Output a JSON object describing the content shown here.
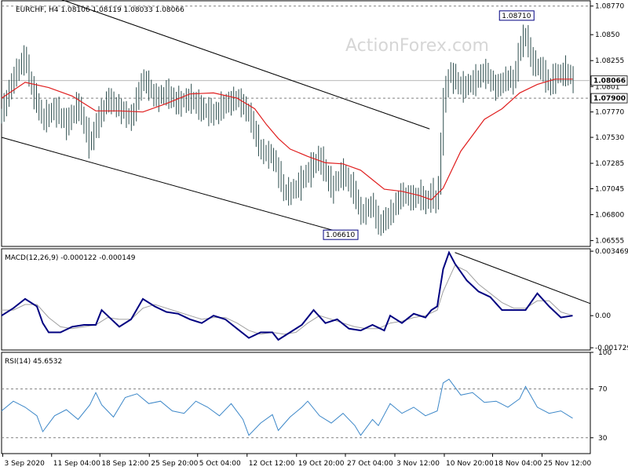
{
  "chart_data": {
    "type": "line",
    "symbol": "EURCHF",
    "timeframe": "H4",
    "watermark": "ActionForex.com",
    "price_panel": {
      "header": "EURCHF, H4  1.08106 1.08119 1.08033 1.08066",
      "price_range": [
        1.065,
        1.0882
      ],
      "y_ticks": [
        "1.08770",
        "1.0850",
        "1.08255",
        "1.0801",
        "1.07770",
        "1.07530",
        "1.07285",
        "1.07045",
        "1.06800",
        "1.06555"
      ],
      "y_tick_values": [
        1.0877,
        1.085,
        1.08255,
        1.0801,
        1.0777,
        1.0753,
        1.07285,
        1.07045,
        1.068,
        1.06555
      ],
      "current_price_label": "1.08066",
      "current_price": 1.08066,
      "support_label": "1.07900",
      "support_level": 1.079,
      "top_dashed_level": 1.0877,
      "annotations": [
        {
          "text": "1.08710",
          "price": 1.0871,
          "t": 0.883
        },
        {
          "text": "1.06610",
          "price": 1.0661,
          "t": 0.584
        }
      ],
      "channel_upper": [
        [
          0.0,
          1.0903
        ],
        [
          0.727,
          1.0761
        ]
      ],
      "channel_lower": [
        [
          0.0,
          1.0753
        ],
        [
          0.59,
          1.0661
        ]
      ],
      "close_path": [
        [
          0.0,
          1.0775
        ],
        [
          0.02,
          1.081
        ],
        [
          0.04,
          1.083
        ],
        [
          0.05,
          1.08
        ],
        [
          0.07,
          1.077
        ],
        [
          0.09,
          1.078
        ],
        [
          0.11,
          1.0765
        ],
        [
          0.13,
          1.0785
        ],
        [
          0.15,
          1.0745
        ],
        [
          0.16,
          1.0765
        ],
        [
          0.18,
          1.079
        ],
        [
          0.2,
          1.078
        ],
        [
          0.22,
          1.077
        ],
        [
          0.24,
          1.081
        ],
        [
          0.26,
          1.079
        ],
        [
          0.28,
          1.0795
        ],
        [
          0.3,
          1.0785
        ],
        [
          0.32,
          1.079
        ],
        [
          0.34,
          1.078
        ],
        [
          0.36,
          1.0775
        ],
        [
          0.38,
          1.0785
        ],
        [
          0.4,
          1.079
        ],
        [
          0.42,
          1.0775
        ],
        [
          0.44,
          1.074
        ],
        [
          0.46,
          1.0735
        ],
        [
          0.47,
          1.072
        ],
        [
          0.48,
          1.07
        ],
        [
          0.5,
          1.0705
        ],
        [
          0.52,
          1.072
        ],
        [
          0.54,
          1.0735
        ],
        [
          0.56,
          1.0705
        ],
        [
          0.58,
          1.072
        ],
        [
          0.6,
          1.07
        ],
        [
          0.61,
          1.068
        ],
        [
          0.63,
          1.069
        ],
        [
          0.64,
          1.067
        ],
        [
          0.66,
          1.068
        ],
        [
          0.68,
          1.07
        ],
        [
          0.7,
          1.0695
        ],
        [
          0.71,
          1.07
        ],
        [
          0.72,
          1.069
        ],
        [
          0.73,
          1.07
        ],
        [
          0.74,
          1.069
        ],
        [
          0.75,
          1.0785
        ],
        [
          0.76,
          1.0815
        ],
        [
          0.78,
          1.08
        ],
        [
          0.8,
          1.0805
        ],
        [
          0.82,
          1.0815
        ],
        [
          0.84,
          1.08
        ],
        [
          0.86,
          1.081
        ],
        [
          0.87,
          1.0805
        ],
        [
          0.88,
          1.084
        ],
        [
          0.89,
          1.085
        ],
        [
          0.9,
          1.0825
        ],
        [
          0.92,
          1.0815
        ],
        [
          0.93,
          1.08
        ],
        [
          0.94,
          1.0812
        ],
        [
          0.96,
          1.0815
        ],
        [
          0.97,
          1.0807
        ]
      ],
      "ma_series": [
        [
          0.0,
          1.079
        ],
        [
          0.04,
          1.0805
        ],
        [
          0.08,
          1.08
        ],
        [
          0.12,
          1.0792
        ],
        [
          0.16,
          1.0778
        ],
        [
          0.2,
          1.0778
        ],
        [
          0.24,
          1.0777
        ],
        [
          0.28,
          1.0785
        ],
        [
          0.32,
          1.0794
        ],
        [
          0.36,
          1.0795
        ],
        [
          0.4,
          1.079
        ],
        [
          0.43,
          1.078
        ],
        [
          0.45,
          1.0765
        ],
        [
          0.47,
          1.0752
        ],
        [
          0.49,
          1.0742
        ],
        [
          0.52,
          1.0735
        ],
        [
          0.55,
          1.0729
        ],
        [
          0.58,
          1.0728
        ],
        [
          0.61,
          1.0722
        ],
        [
          0.63,
          1.0713
        ],
        [
          0.65,
          1.0704
        ],
        [
          0.68,
          1.0702
        ],
        [
          0.71,
          1.0698
        ],
        [
          0.73,
          1.0694
        ],
        [
          0.75,
          1.0705
        ],
        [
          0.78,
          1.074
        ],
        [
          0.82,
          1.077
        ],
        [
          0.85,
          1.078
        ],
        [
          0.88,
          1.0795
        ],
        [
          0.91,
          1.0803
        ],
        [
          0.94,
          1.0808
        ],
        [
          0.97,
          1.0808
        ]
      ]
    },
    "macd_panel": {
      "header": "MACD(12,26,9) -0.000122 -0.000149",
      "range": [
        -0.00185,
        0.0036
      ],
      "y_ticks": [
        "0.003469",
        "0.00",
        "-0.001729"
      ],
      "y_tick_values": [
        0.003469,
        0.0,
        -0.001729
      ],
      "macd": [
        [
          0.0,
          0.0
        ],
        [
          0.02,
          0.0004
        ],
        [
          0.04,
          0.0009
        ],
        [
          0.06,
          0.0005
        ],
        [
          0.07,
          -0.0004
        ],
        [
          0.08,
          -0.0009
        ],
        [
          0.1,
          -0.0009
        ],
        [
          0.12,
          -0.0006
        ],
        [
          0.14,
          -0.0005
        ],
        [
          0.16,
          -0.0005
        ],
        [
          0.17,
          0.0003
        ],
        [
          0.18,
          0.0
        ],
        [
          0.2,
          -0.0006
        ],
        [
          0.22,
          -0.0002
        ],
        [
          0.24,
          0.0009
        ],
        [
          0.26,
          0.0005
        ],
        [
          0.28,
          0.0002
        ],
        [
          0.3,
          0.0001
        ],
        [
          0.32,
          -0.0002
        ],
        [
          0.34,
          -0.0004
        ],
        [
          0.36,
          0.0
        ],
        [
          0.38,
          -0.0002
        ],
        [
          0.4,
          -0.0007
        ],
        [
          0.42,
          -0.0012
        ],
        [
          0.44,
          -0.0009
        ],
        [
          0.46,
          -0.0009
        ],
        [
          0.47,
          -0.0013
        ],
        [
          0.49,
          -0.0009
        ],
        [
          0.51,
          -0.0005
        ],
        [
          0.53,
          0.0003
        ],
        [
          0.55,
          -0.0004
        ],
        [
          0.57,
          -0.0002
        ],
        [
          0.59,
          -0.0007
        ],
        [
          0.61,
          -0.0008
        ],
        [
          0.63,
          -0.0005
        ],
        [
          0.65,
          -0.0008
        ],
        [
          0.66,
          0.0
        ],
        [
          0.68,
          -0.0004
        ],
        [
          0.7,
          0.0001
        ],
        [
          0.72,
          -0.0001
        ],
        [
          0.73,
          0.0003
        ],
        [
          0.74,
          0.0005
        ],
        [
          0.75,
          0.0025
        ],
        [
          0.76,
          0.0034
        ],
        [
          0.77,
          0.0028
        ],
        [
          0.79,
          0.0019
        ],
        [
          0.81,
          0.0013
        ],
        [
          0.83,
          0.001
        ],
        [
          0.85,
          0.0003
        ],
        [
          0.87,
          0.0003
        ],
        [
          0.89,
          0.0003
        ],
        [
          0.91,
          0.0012
        ],
        [
          0.93,
          0.0005
        ],
        [
          0.95,
          -0.0001
        ],
        [
          0.97,
          0.0
        ]
      ],
      "signal": [
        [
          0.0,
          0.0003
        ],
        [
          0.02,
          0.0003
        ],
        [
          0.04,
          0.0006
        ],
        [
          0.06,
          0.0006
        ],
        [
          0.08,
          -0.0001
        ],
        [
          0.1,
          -0.0006
        ],
        [
          0.12,
          -0.0007
        ],
        [
          0.14,
          -0.0006
        ],
        [
          0.16,
          -0.0005
        ],
        [
          0.18,
          -0.0001
        ],
        [
          0.2,
          -0.0002
        ],
        [
          0.22,
          -0.0002
        ],
        [
          0.24,
          0.0004
        ],
        [
          0.26,
          0.0006
        ],
        [
          0.28,
          0.0004
        ],
        [
          0.3,
          0.0002
        ],
        [
          0.32,
          0.0
        ],
        [
          0.34,
          -0.0002
        ],
        [
          0.36,
          -0.0001
        ],
        [
          0.38,
          -0.0001
        ],
        [
          0.4,
          -0.0004
        ],
        [
          0.42,
          -0.0008
        ],
        [
          0.44,
          -0.001
        ],
        [
          0.46,
          -0.0009
        ],
        [
          0.48,
          -0.001
        ],
        [
          0.5,
          -0.0009
        ],
        [
          0.52,
          -0.0004
        ],
        [
          0.54,
          0.0
        ],
        [
          0.56,
          -0.0002
        ],
        [
          0.58,
          -0.0004
        ],
        [
          0.6,
          -0.0006
        ],
        [
          0.62,
          -0.0007
        ],
        [
          0.64,
          -0.0007
        ],
        [
          0.66,
          -0.0004
        ],
        [
          0.68,
          -0.0003
        ],
        [
          0.7,
          -0.0001
        ],
        [
          0.72,
          0.0
        ],
        [
          0.74,
          0.0003
        ],
        [
          0.75,
          0.0013
        ],
        [
          0.77,
          0.0027
        ],
        [
          0.79,
          0.0024
        ],
        [
          0.81,
          0.0017
        ],
        [
          0.83,
          0.0012
        ],
        [
          0.85,
          0.0007
        ],
        [
          0.87,
          0.0004
        ],
        [
          0.89,
          0.0004
        ],
        [
          0.91,
          0.0008
        ],
        [
          0.93,
          0.0008
        ],
        [
          0.95,
          0.0002
        ],
        [
          0.97,
          0.0
        ]
      ],
      "trendline": [
        [
          0.77,
          0.0034
        ],
        [
          1.0,
          0.00065
        ]
      ]
    },
    "rsi_panel": {
      "header": "RSI(14) 45.6532",
      "range": [
        17,
        100
      ],
      "y_ticks": [
        "100",
        "70",
        "30"
      ],
      "y_tick_values": [
        100,
        70,
        30
      ],
      "dashed_levels": [
        70,
        30
      ],
      "rsi": [
        [
          0.0,
          52
        ],
        [
          0.02,
          60
        ],
        [
          0.04,
          55
        ],
        [
          0.06,
          48
        ],
        [
          0.07,
          35
        ],
        [
          0.09,
          48
        ],
        [
          0.11,
          53
        ],
        [
          0.13,
          45
        ],
        [
          0.15,
          57
        ],
        [
          0.16,
          67
        ],
        [
          0.17,
          57
        ],
        [
          0.19,
          47
        ],
        [
          0.21,
          63
        ],
        [
          0.23,
          66
        ],
        [
          0.25,
          58
        ],
        [
          0.27,
          60
        ],
        [
          0.29,
          52
        ],
        [
          0.31,
          50
        ],
        [
          0.33,
          60
        ],
        [
          0.35,
          55
        ],
        [
          0.37,
          48
        ],
        [
          0.39,
          58
        ],
        [
          0.41,
          45
        ],
        [
          0.42,
          32
        ],
        [
          0.44,
          42
        ],
        [
          0.46,
          49
        ],
        [
          0.47,
          36
        ],
        [
          0.49,
          47
        ],
        [
          0.51,
          55
        ],
        [
          0.52,
          60
        ],
        [
          0.54,
          48
        ],
        [
          0.56,
          42
        ],
        [
          0.58,
          50
        ],
        [
          0.6,
          40
        ],
        [
          0.61,
          32
        ],
        [
          0.63,
          45
        ],
        [
          0.64,
          40
        ],
        [
          0.66,
          58
        ],
        [
          0.68,
          50
        ],
        [
          0.7,
          55
        ],
        [
          0.72,
          48
        ],
        [
          0.74,
          52
        ],
        [
          0.75,
          75
        ],
        [
          0.76,
          78
        ],
        [
          0.78,
          65
        ],
        [
          0.8,
          67
        ],
        [
          0.82,
          59
        ],
        [
          0.84,
          60
        ],
        [
          0.86,
          55
        ],
        [
          0.88,
          62
        ],
        [
          0.89,
          72
        ],
        [
          0.91,
          55
        ],
        [
          0.93,
          50
        ],
        [
          0.95,
          52
        ],
        [
          0.97,
          46
        ]
      ]
    },
    "x_ticks": [
      "3 Sep 2020",
      "11 Sep 04:00",
      "18 Sep 12:00",
      "25 Sep 20:00",
      "5 Oct 04:00",
      "12 Oct 12:00",
      "19 Oct 20:00",
      "27 Oct 04:00",
      "3 Nov 12:00",
      "10 Nov 20:00",
      "18 Nov 04:00",
      "25 Nov 12:00"
    ],
    "x_tick_positions": [
      0.002,
      0.085,
      0.167,
      0.251,
      0.333,
      0.417,
      0.501,
      0.584,
      0.668,
      0.752,
      0.834,
      0.918
    ],
    "colors": {
      "background": "#ffffff",
      "border": "#000000",
      "candles": "#2f4f4f",
      "ma": "#e01f1f",
      "macd": "#000080",
      "signal": "#a0a0a0",
      "rsi": "#3c87c8",
      "channel": "#000000",
      "grid_dashed": "#808080",
      "watermark": "#d6d6d6"
    }
  }
}
